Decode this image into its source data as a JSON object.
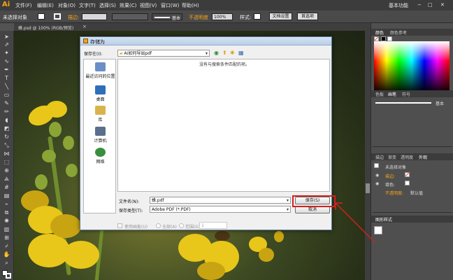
{
  "app": {
    "logo": "Ai",
    "menu": [
      "文件(F)",
      "编辑(E)",
      "对象(O)",
      "文字(T)",
      "选择(S)",
      "效果(C)",
      "视图(V)",
      "窗口(W)",
      "帮助(H)"
    ],
    "workspace": "基本功能",
    "window_controls": [
      "−",
      "□",
      "✕"
    ]
  },
  "control_bar": {
    "selection": "未选择对象",
    "stroke_label": "描边:",
    "stroke_profile": "基本",
    "opacity_label": "不透明度",
    "opacity_value": "100%",
    "style_label": "样式:",
    "doc_setup_button": "文档设置",
    "preferences_button": "首选项"
  },
  "document": {
    "tab_title": "蜂.psd @ 100% (RGB/预览)",
    "close": "×"
  },
  "save_dialog": {
    "title": "存储为",
    "save_in_label": "保存在(I):",
    "save_in_value": "Ai如何导出pdf",
    "empty_message": "没有与搜索条件匹配的项。",
    "places": [
      {
        "label": "最近访问的位置",
        "icon": "recent-places-icon",
        "color": "#6a8fc7"
      },
      {
        "label": "桌面",
        "icon": "desktop-icon",
        "color": "#2e6fb8"
      },
      {
        "label": "库",
        "icon": "library-icon",
        "color": "#d9b44a"
      },
      {
        "label": "计算机",
        "icon": "computer-icon",
        "color": "#5a6e8e"
      },
      {
        "label": "网络",
        "icon": "network-icon",
        "color": "#3a8f3f"
      }
    ],
    "filename_label": "文件名(N):",
    "filename_value": "蜂.pdf",
    "filetype_label": "保存类型(T):",
    "filetype_value": "Adobe PDF (*.PDF)",
    "save_button": "保存(S)",
    "cancel_button": "取消",
    "use_artboards": "使用画板(U)",
    "all_option": "全部(A)",
    "range_option": "范围(G):",
    "range_value": "1",
    "highlight_color": "#d42020"
  },
  "panels": {
    "color_tabs": [
      "颜色",
      "颜色参考"
    ],
    "stroke_tabs": [
      "色板",
      "画笔",
      "符号"
    ],
    "brush_label": "基本",
    "appearance_tabs": [
      "描边",
      "渐变",
      "透明度",
      "外观"
    ],
    "appearance_title": "未选择对象",
    "appearance_rows": [
      {
        "label": "描边:",
        "value": ""
      },
      {
        "label": "填色:",
        "value": ""
      },
      {
        "label": "不透明度:",
        "value": "默认值"
      }
    ],
    "graphic_styles_tab": "图形样式",
    "stroke_label_color": "#f7a21b"
  }
}
